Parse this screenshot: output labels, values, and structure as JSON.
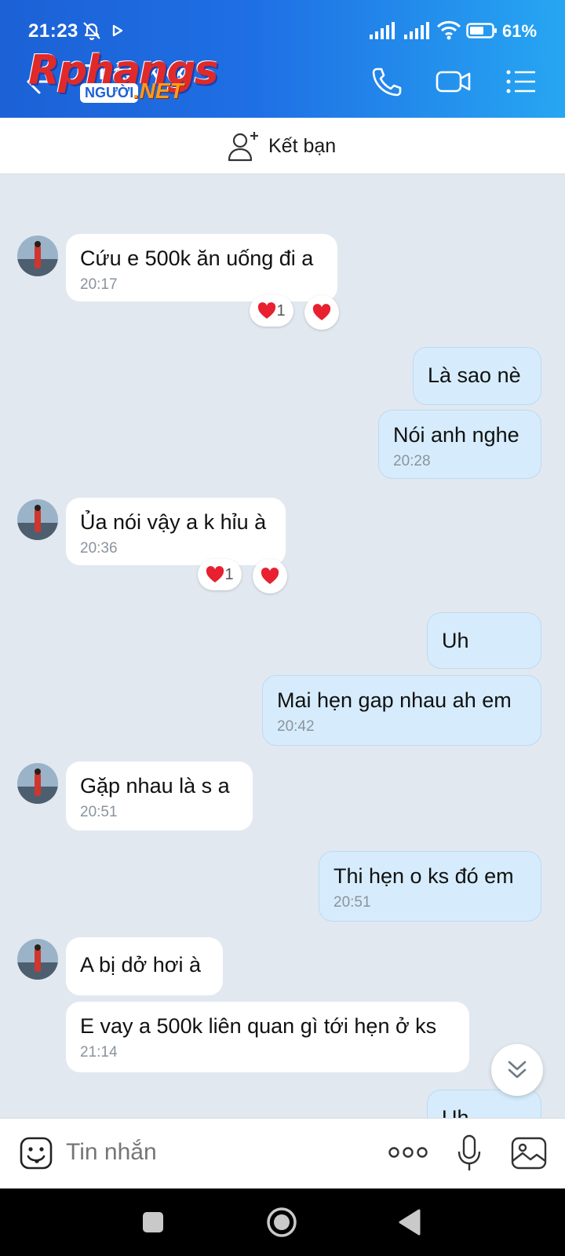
{
  "status_bar": {
    "time": "21:23",
    "battery": "61%"
  },
  "header": {
    "contact_name": "Thảo Xxx",
    "watermark_main": "Rphangs",
    "watermark_badge": "NGƯỜI",
    "watermark_net": ".NET"
  },
  "add_friend": {
    "label": "Kết bạn"
  },
  "messages": [
    {
      "dir": "in",
      "text": "Cứu e 500k ăn uống đi a",
      "time": "20:17",
      "reaction_count": "1"
    },
    {
      "dir": "out",
      "text": "Là sao nè",
      "time": ""
    },
    {
      "dir": "out",
      "text": "Nói anh nghe",
      "time": "20:28"
    },
    {
      "dir": "in",
      "text": "Ủa nói vậy a k hỉu à",
      "time": "20:36",
      "reaction_count": "1"
    },
    {
      "dir": "out",
      "text": "Uh",
      "time": ""
    },
    {
      "dir": "out",
      "text": "Mai hẹn gap nhau ah em",
      "time": "20:42"
    },
    {
      "dir": "in",
      "text": "Gặp nhau là s a",
      "time": "20:51"
    },
    {
      "dir": "out",
      "text": "Thi hẹn o ks đó em",
      "time": "20:51"
    },
    {
      "dir": "in",
      "text": "A bị dở hơi à",
      "time": ""
    },
    {
      "dir": "in",
      "text": "E vay a 500k liên quan gì tới hẹn ở ks",
      "time": "21:14"
    },
    {
      "dir": "out",
      "text": "Uh",
      "time": ""
    }
  ],
  "input": {
    "placeholder": "Tin nhắn"
  },
  "colors": {
    "header_start": "#1c61d6",
    "header_end": "#26a6f2",
    "outgoing_bubble": "#d6ecfc",
    "incoming_bubble": "#ffffff",
    "chat_bg": "#e2e8f0",
    "heart": "#e8202f"
  }
}
